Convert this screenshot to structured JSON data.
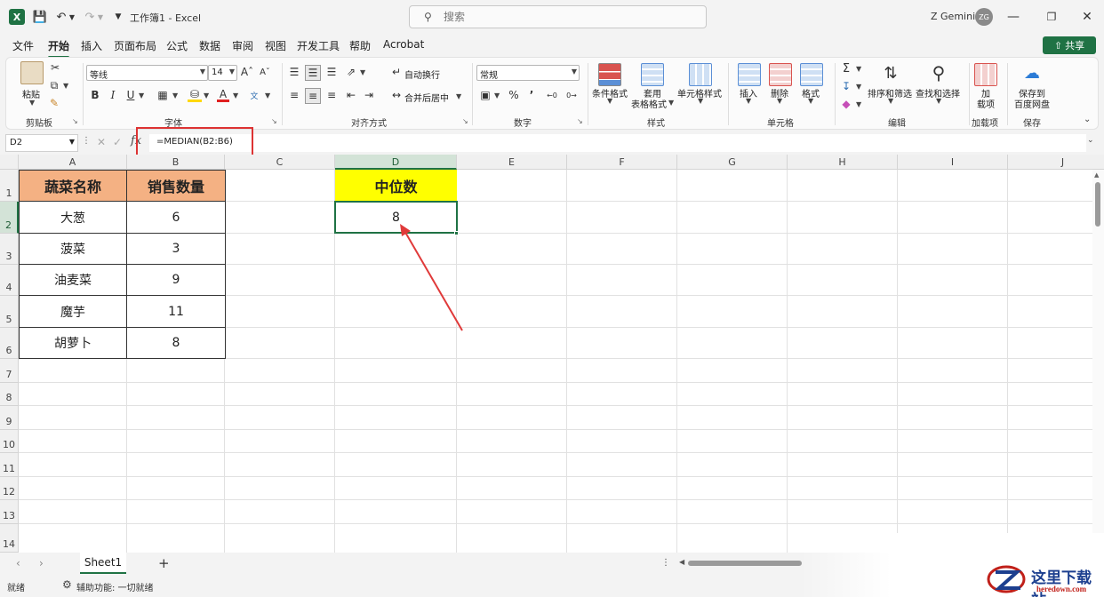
{
  "app": {
    "document_title": "工作簿1 - Excel",
    "user_name": "Z Gemini",
    "user_initials": "ZG",
    "search_placeholder": "搜索"
  },
  "menu": {
    "tabs": [
      "文件",
      "开始",
      "插入",
      "页面布局",
      "公式",
      "数据",
      "审阅",
      "视图",
      "开发工具",
      "帮助",
      "Acrobat"
    ],
    "active_tab": "开始",
    "share_label": "共享"
  },
  "ribbon": {
    "clipboard": {
      "paste": "粘贴",
      "group": "剪贴板"
    },
    "font": {
      "name": "等线",
      "size": "14",
      "group": "字体"
    },
    "alignment": {
      "wrap": "自动换行",
      "merge": "合并后居中",
      "group": "对齐方式"
    },
    "number": {
      "format": "常规",
      "group": "数字"
    },
    "styles": {
      "conditional": "条件格式",
      "table_line1": "套用",
      "table_line2": "表格格式",
      "cell_styles": "单元格样式",
      "group": "样式"
    },
    "cells": {
      "insert": "插入",
      "delete": "删除",
      "format": "格式",
      "group": "单元格"
    },
    "editing": {
      "sort": "排序和筛选",
      "find": "查找和选择",
      "group": "编辑"
    },
    "addins": {
      "line1": "加",
      "line2": "载项",
      "group": "加载项"
    },
    "save": {
      "line1": "保存到",
      "line2": "百度网盘",
      "group": "保存"
    }
  },
  "formula_bar": {
    "name_box": "D2",
    "formula": "=MEDIAN(B2:B6)"
  },
  "sheet": {
    "columns": [
      "A",
      "B",
      "C",
      "D",
      "E",
      "F",
      "G",
      "H",
      "I",
      "J"
    ],
    "selected_column": "D",
    "rows": [
      "1",
      "2",
      "3",
      "4",
      "5",
      "6",
      "7",
      "8",
      "9",
      "10",
      "11",
      "12",
      "13",
      "14"
    ],
    "selected_row": "2",
    "table_headers": [
      "蔬菜名称",
      "销售数量"
    ],
    "table_rows": [
      [
        "大葱",
        "6"
      ],
      [
        "菠菜",
        "3"
      ],
      [
        "油麦菜",
        "9"
      ],
      [
        "魔芋",
        "11"
      ],
      [
        "胡萝卜",
        "8"
      ]
    ],
    "median_header": "中位数",
    "median_value": "8"
  },
  "sheet_tabs": {
    "active": "Sheet1"
  },
  "status": {
    "ready": "就绪",
    "accessibility": "辅助功能: 一切就绪"
  },
  "watermark": {
    "text": "这里下载站",
    "url": "heredown.com"
  },
  "colors": {
    "excel_green": "#1f7244",
    "header_fill": "#f4b183",
    "median_fill": "#ffff00",
    "annotation_red": "#dd3333"
  }
}
